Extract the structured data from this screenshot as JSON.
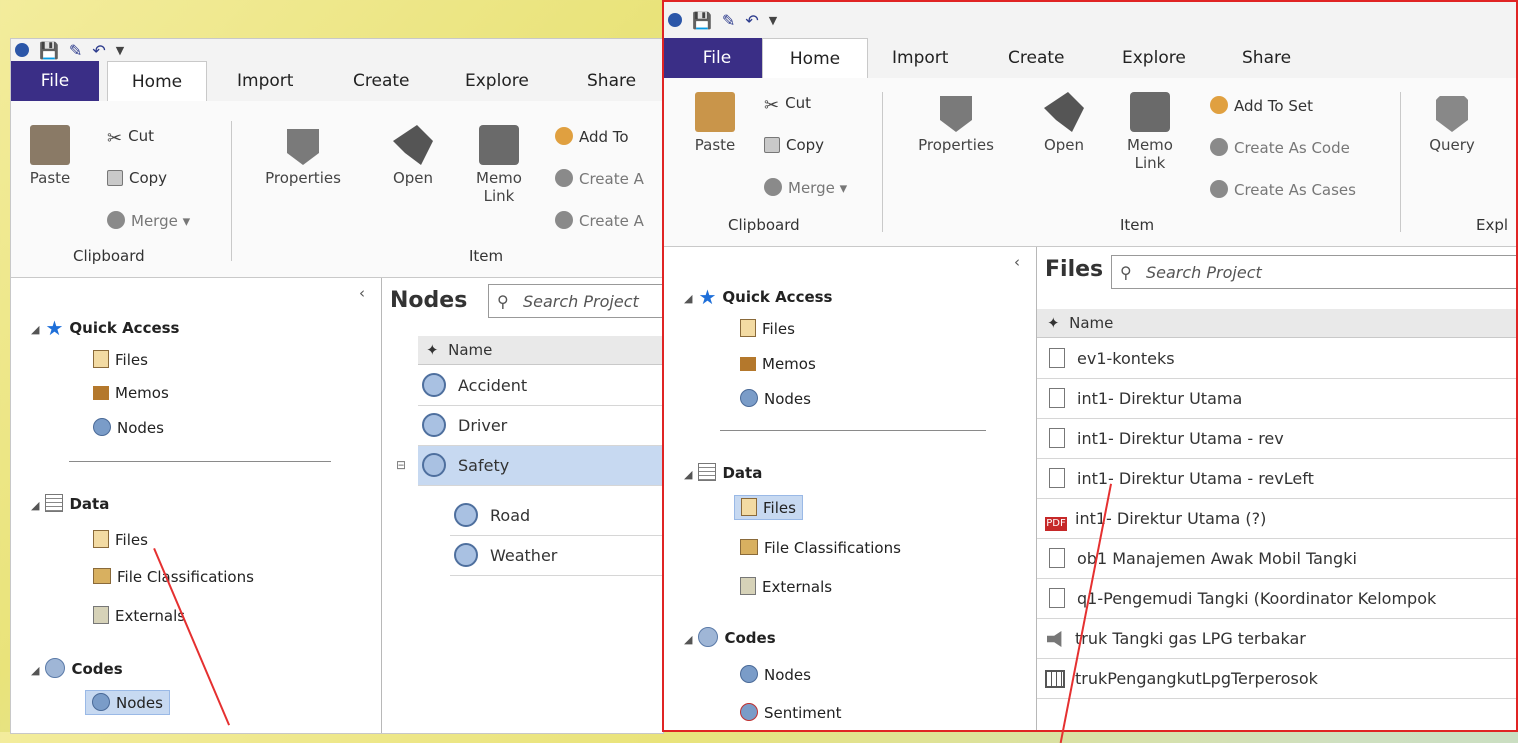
{
  "ribbon": {
    "tabs": [
      "File",
      "Home",
      "Import",
      "Create",
      "Explore",
      "Share"
    ],
    "paste": "Paste",
    "cut": "Cut",
    "copy": "Copy",
    "merge": "Merge",
    "clipboard_group": "Clipboard",
    "properties": "Properties",
    "open": "Open",
    "memo_link_1": "Memo",
    "memo_link_2": "Link",
    "item_group": "Item",
    "add_to_set": "Add To Set",
    "create_as_code": "Create As Code",
    "create_as_cases": "Create As Cases",
    "query": "Query",
    "explore_group_partial": "Expl",
    "left_add_partial": "Add To",
    "left_create_1": "Create A",
    "left_create_2": "Create A"
  },
  "left": {
    "nav": {
      "quick_access": "Quick Access",
      "qa_files": "Files",
      "qa_memos": "Memos",
      "qa_nodes": "Nodes",
      "data": "Data",
      "data_files": "Files",
      "file_classifications": "File Classifications",
      "externals": "Externals",
      "codes": "Codes",
      "codes_nodes": "Nodes"
    },
    "content": {
      "title": "Nodes",
      "search_placeholder": "Search Project",
      "col_name": "Name",
      "rows": [
        "Accident",
        "Driver",
        "Safety",
        "Road",
        "Weather"
      ]
    }
  },
  "right": {
    "nav": {
      "quick_access": "Quick Access",
      "qa_files": "Files",
      "qa_memos": "Memos",
      "qa_nodes": "Nodes",
      "data": "Data",
      "data_files": "Files",
      "file_classifications": "File Classifications",
      "externals": "Externals",
      "codes": "Codes",
      "codes_nodes": "Nodes",
      "sentiment": "Sentiment"
    },
    "content": {
      "title": "Files",
      "search_placeholder": "Search Project",
      "col_name": "Name",
      "rows": [
        {
          "name": "ev1-konteks",
          "icon": "document-icon"
        },
        {
          "name": "int1- Direktur Utama",
          "icon": "document-icon"
        },
        {
          "name": "int1- Direktur Utama - rev",
          "icon": "document-icon"
        },
        {
          "name": "int1- Direktur Utama - revLeft",
          "icon": "document-icon"
        },
        {
          "name": "int1- Direktur Utama (?)",
          "icon": "pdf-icon"
        },
        {
          "name": "ob1 Manajemen Awak Mobil Tangki",
          "icon": "document-icon"
        },
        {
          "name": "q1-Pengemudi Tangki (Koordinator Kelompok",
          "icon": "document-icon"
        },
        {
          "name": "truk Tangki gas LPG terbakar",
          "icon": "audio-icon"
        },
        {
          "name": "trukPengangkutLpgTerperosok",
          "icon": "video-icon"
        }
      ]
    }
  },
  "colors": {
    "file_tab": "#3a2e86",
    "selection": "#c7d9f1",
    "highlight_border": "#e02424",
    "annotation_line": "#e53030"
  }
}
